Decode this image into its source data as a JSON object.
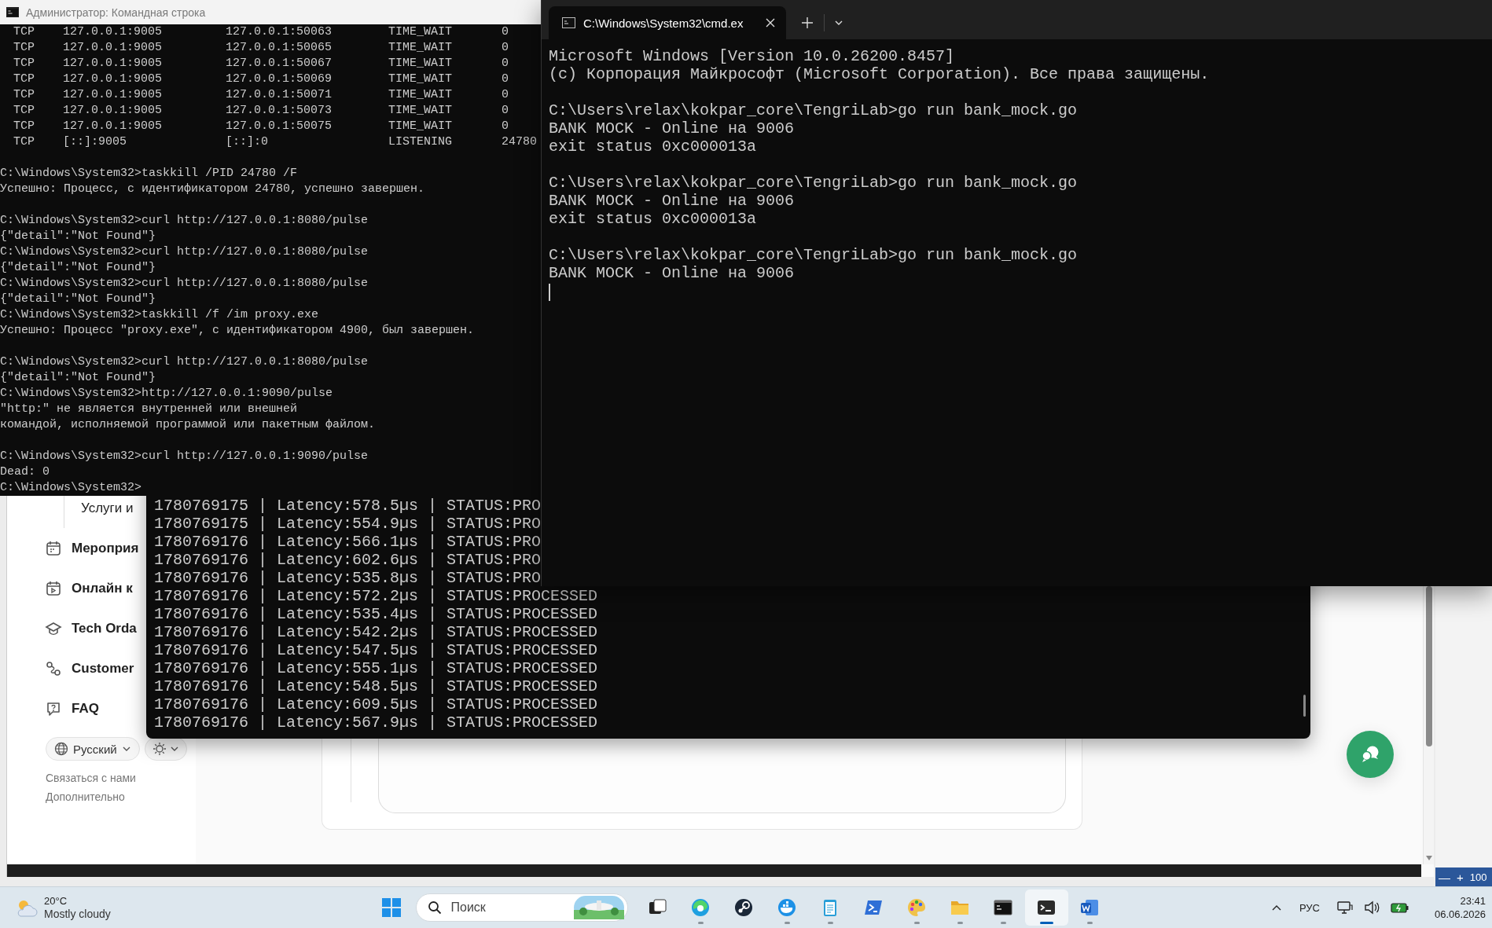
{
  "admin_console": {
    "title": "Администратор: Командная строка",
    "connections": [
      {
        "protocol": "TCP",
        "local_address": "127.0.0.1:9005",
        "foreign_address": "127.0.0.1:50063",
        "state": "TIME_WAIT",
        "pid": "0"
      },
      {
        "protocol": "TCP",
        "local_address": "127.0.0.1:9005",
        "foreign_address": "127.0.0.1:50065",
        "state": "TIME_WAIT",
        "pid": "0"
      },
      {
        "protocol": "TCP",
        "local_address": "127.0.0.1:9005",
        "foreign_address": "127.0.0.1:50067",
        "state": "TIME_WAIT",
        "pid": "0"
      },
      {
        "protocol": "TCP",
        "local_address": "127.0.0.1:9005",
        "foreign_address": "127.0.0.1:50069",
        "state": "TIME_WAIT",
        "pid": "0"
      },
      {
        "protocol": "TCP",
        "local_address": "127.0.0.1:9005",
        "foreign_address": "127.0.0.1:50071",
        "state": "TIME_WAIT",
        "pid": "0"
      },
      {
        "protocol": "TCP",
        "local_address": "127.0.0.1:9005",
        "foreign_address": "127.0.0.1:50073",
        "state": "TIME_WAIT",
        "pid": "0"
      },
      {
        "protocol": "TCP",
        "local_address": "127.0.0.1:9005",
        "foreign_address": "127.0.0.1:50075",
        "state": "TIME_WAIT",
        "pid": "0"
      },
      {
        "protocol": "TCP",
        "local_address": "[::]:9005",
        "foreign_address": "[::]:0",
        "state": "LISTENING",
        "pid": "24780"
      }
    ],
    "blocks": [
      [
        "C:\\Windows\\System32>taskkill /PID 24780 /F",
        "Успешно: Процесс, с идентификатором 24780, успешно завершен."
      ],
      [
        "C:\\Windows\\System32>curl http://127.0.0.1:8080/pulse",
        "{\"detail\":\"Not Found\"}",
        "C:\\Windows\\System32>curl http://127.0.0.1:8080/pulse",
        "{\"detail\":\"Not Found\"}",
        "C:\\Windows\\System32>curl http://127.0.0.1:8080/pulse",
        "{\"detail\":\"Not Found\"}",
        "C:\\Windows\\System32>taskkill /f /im proxy.exe",
        "Успешно: Процесс \"proxy.exe\", с идентификатором 4900, был завершен."
      ],
      [
        "C:\\Windows\\System32>curl http://127.0.0.1:8080/pulse",
        "{\"detail\":\"Not Found\"}",
        "C:\\Windows\\System32>http://127.0.0.1:9090/pulse",
        "\"http:\" не является внутренней или внешней",
        "командой, исполняемой программой или пакетным файлом."
      ],
      [
        "C:\\Windows\\System32>curl http://127.0.0.1:9090/pulse",
        "Dead: 0",
        "C:\\Windows\\System32>"
      ]
    ]
  },
  "terminal": {
    "tab_title": "C:\\Windows\\System32\\cmd.ex",
    "blocks": [
      [
        "Microsoft Windows [Version 10.0.26200.8457]",
        "(c) Корпорация Майкрософт (Microsoft Corporation). Все права защищены."
      ],
      [
        "C:\\Users\\relax\\kokpar_core\\TengriLab>go run bank_mock.go",
        "BANK MOCK - Online на 9006",
        "exit status 0xc000013a"
      ],
      [
        "C:\\Users\\relax\\kokpar_core\\TengriLab>go run bank_mock.go",
        "BANK MOCK - Online на 9006",
        "exit status 0xc000013a"
      ],
      [
        "C:\\Users\\relax\\kokpar_core\\TengriLab>go run bank_mock.go",
        "BANK MOCK - Online на 9006"
      ]
    ]
  },
  "latency_log": {
    "rows": [
      "1780769175 | Latency:578.5µs | STATUS:PRO",
      "1780769175 | Latency:554.9µs | STATUS:PRO",
      "1780769176 | Latency:566.1µs | STATUS:PRO",
      "1780769176 | Latency:602.6µs | STATUS:PRO",
      "1780769176 | Latency:535.8µs | STATUS:PRO",
      "1780769176 | Latency:572.2µs | STATUS:PROCESSED",
      "1780769176 | Latency:535.4µs | STATUS:PROCESSED",
      "1780769176 | Latency:542.2µs | STATUS:PROCESSED",
      "1780769176 | Latency:547.5µs | STATUS:PROCESSED",
      "1780769176 | Latency:555.1µs | STATUS:PROCESSED",
      "1780769176 | Latency:548.5µs | STATUS:PROCESSED",
      "1780769176 | Latency:609.5µs | STATUS:PROCESSED",
      "1780769176 | Latency:567.9µs | STATUS:PROCESSED"
    ]
  },
  "browser": {
    "sidebar_items": [
      {
        "kind": "subitem",
        "label": "Услуги и"
      },
      {
        "kind": "item",
        "label": "Мероприя"
      },
      {
        "kind": "item",
        "label": "Онлайн к"
      },
      {
        "kind": "item",
        "label": "Tech Orda"
      },
      {
        "kind": "item",
        "label": "Customer"
      },
      {
        "kind": "item",
        "label": "FAQ"
      }
    ],
    "language_selector": {
      "label": "Русский"
    },
    "footer_links": [
      "Связаться с нами",
      "Дополнительно"
    ]
  },
  "background_window": {
    "zoom_out": "—",
    "zoom_in": "+",
    "zoom_value": "100"
  },
  "taskbar": {
    "weather": {
      "temperature": "20°C",
      "condition": "Mostly cloudy"
    },
    "search": {
      "placeholder": "Поиск"
    },
    "apps": [
      {
        "running": false,
        "selected": false
      },
      {
        "running": true,
        "selected": false
      },
      {
        "running": false,
        "selected": false
      },
      {
        "running": true,
        "selected": false
      },
      {
        "running": true,
        "selected": false
      },
      {
        "running": false,
        "selected": false
      },
      {
        "running": true,
        "selected": false
      },
      {
        "running": true,
        "selected": false
      },
      {
        "running": true,
        "selected": false
      },
      {
        "running": true,
        "selected": true
      },
      {
        "running": true,
        "selected": false
      }
    ],
    "language": "РУС",
    "time": "23:41",
    "date": "06.06.2026"
  }
}
